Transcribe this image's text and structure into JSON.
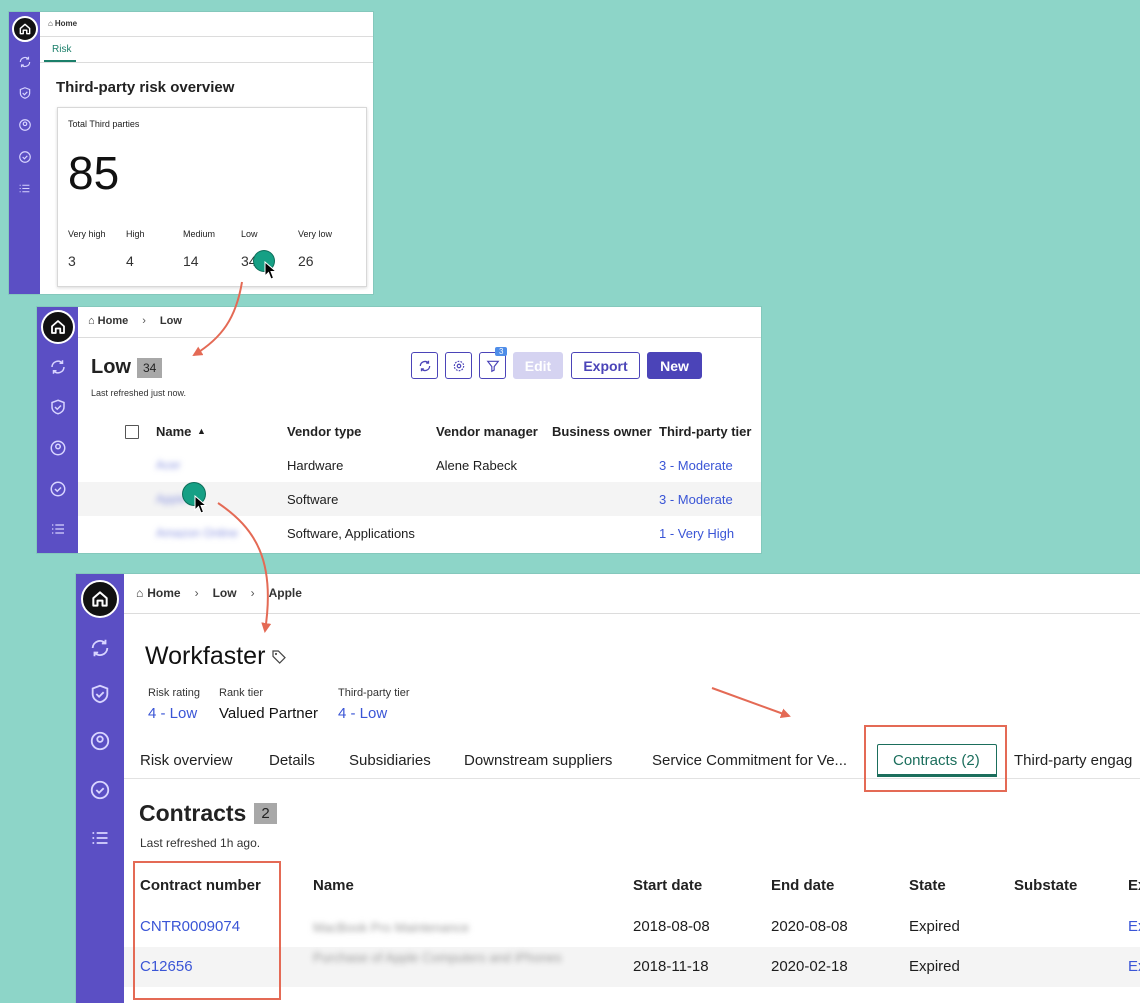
{
  "panel1": {
    "breadcrumb_home": "Home",
    "tab": "Risk",
    "title": "Third-party risk overview",
    "card_label": "Total Third parties",
    "total": "85",
    "levels": [
      {
        "label": "Very high",
        "value": "3"
      },
      {
        "label": "High",
        "value": "4"
      },
      {
        "label": "Medium",
        "value": "14"
      },
      {
        "label": "Low",
        "value": "34"
      },
      {
        "label": "Very low",
        "value": "26"
      }
    ]
  },
  "panel2": {
    "breadcrumb": {
      "home": "Home",
      "current": "Low"
    },
    "title": "Low",
    "count": "34",
    "refreshed": "Last refreshed just now.",
    "filter_badge": "3",
    "buttons": {
      "edit": "Edit",
      "export": "Export",
      "new": "New"
    },
    "columns": [
      "Name",
      "Vendor type",
      "Vendor manager",
      "Business owner",
      "Third-party tier"
    ],
    "rows": [
      {
        "name": "Acer",
        "vendor_type": "Hardware",
        "vendor_manager": "Alene Rabeck",
        "business_owner": "",
        "tier": "3 - Moderate"
      },
      {
        "name": "Apple",
        "vendor_type": "Software",
        "vendor_manager": "",
        "business_owner": "",
        "tier": "3 - Moderate"
      },
      {
        "name": "Amazon Online",
        "vendor_type": "Software, Applications",
        "vendor_manager": "",
        "business_owner": "",
        "tier": "1 - Very High"
      }
    ]
  },
  "panel3": {
    "breadcrumb": {
      "home": "Home",
      "mid": "Low",
      "current": "Apple"
    },
    "title": "Workfaster",
    "meta": [
      {
        "label": "Risk rating",
        "value": "4 - Low"
      },
      {
        "label": "Rank tier",
        "value": "Valued Partner"
      },
      {
        "label": "Third-party tier",
        "value": "4 - Low"
      }
    ],
    "tabs": [
      "Risk overview",
      "Details",
      "Subsidiaries",
      "Downstream suppliers",
      "Service Commitment for Ve...",
      "Contracts (2)",
      "Third-party engag"
    ],
    "section_title": "Contracts",
    "section_count": "2",
    "refreshed": "Last refreshed 1h ago.",
    "columns": [
      "Contract number",
      "Name",
      "Start date",
      "End date",
      "State",
      "Substate",
      "Ex"
    ],
    "rows": [
      {
        "number": "CNTR0009074",
        "name": "MacBook Pro Maintenance",
        "start": "2018-08-08",
        "end": "2020-08-08",
        "state": "Expired",
        "substate": "",
        "extra": "Ex"
      },
      {
        "number": "C12656",
        "name": "Purchase of Apple Computers and iPhones",
        "start": "2018-11-18",
        "end": "2020-02-18",
        "state": "Expired",
        "substate": "",
        "extra": "Ex"
      }
    ]
  },
  "colors": {
    "background": "#8dd5c8",
    "rail": "#5b4fc4",
    "link": "#3a55d6",
    "accent_green": "#16a085",
    "highlight": "#e46a55",
    "button": "#4b44b8"
  }
}
